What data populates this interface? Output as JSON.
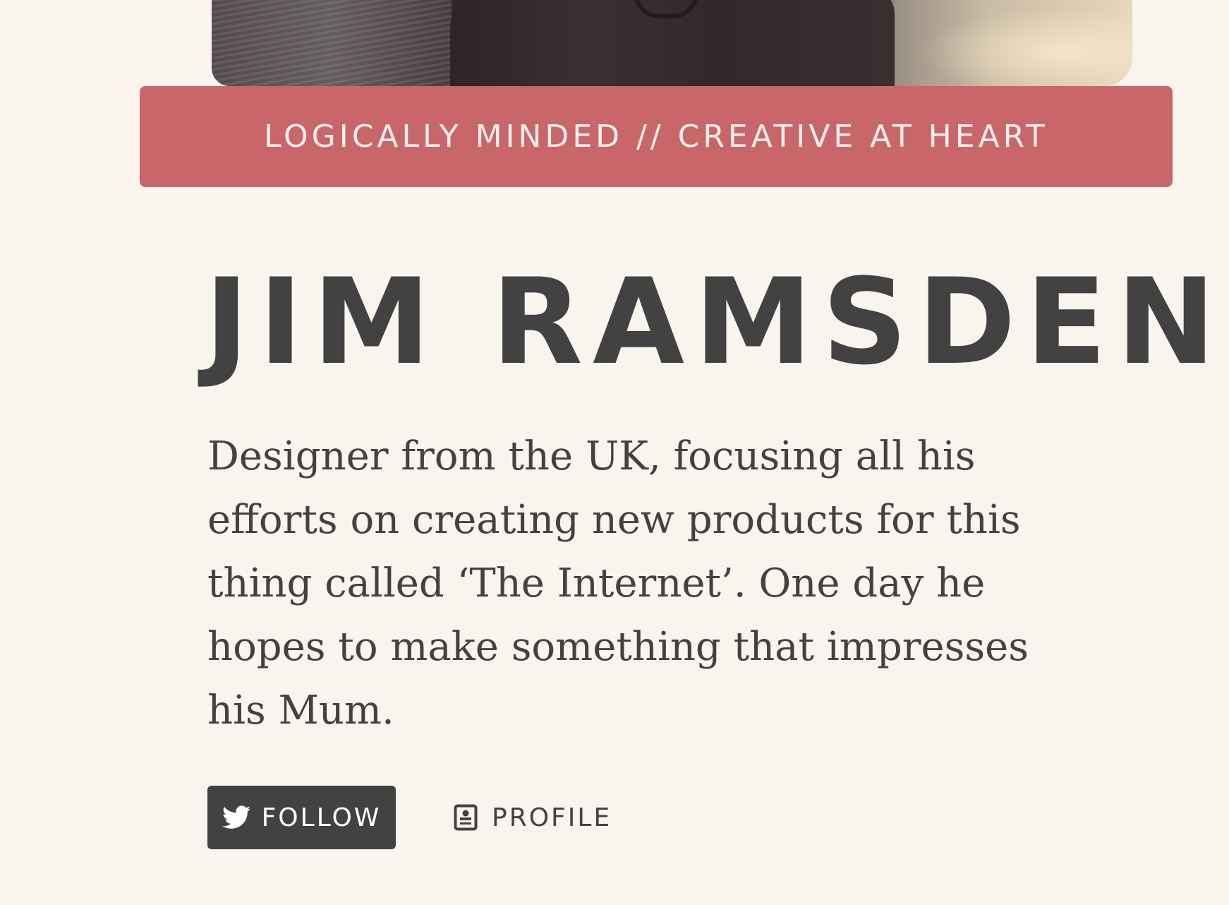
{
  "hero": {
    "image_label": "portrait photo"
  },
  "tagline": "LOGICALLY MINDED // CREATIVE AT HEART",
  "name": "JIM RAMSDEN",
  "bio": "Designer from the UK, focusing all his efforts on creating new products for this thing called ‘The Internet’. One day he hopes to make something that impresses his Mum.",
  "actions": {
    "follow_label": "FOLLOW",
    "follow_icon": "twitter-bird-icon",
    "profile_label": "PROFILE",
    "profile_icon": "profile-card-icon"
  },
  "colors": {
    "background": "#f9f4ee",
    "accent": "#c9666a",
    "text": "#424242",
    "button_bg": "#424242"
  }
}
